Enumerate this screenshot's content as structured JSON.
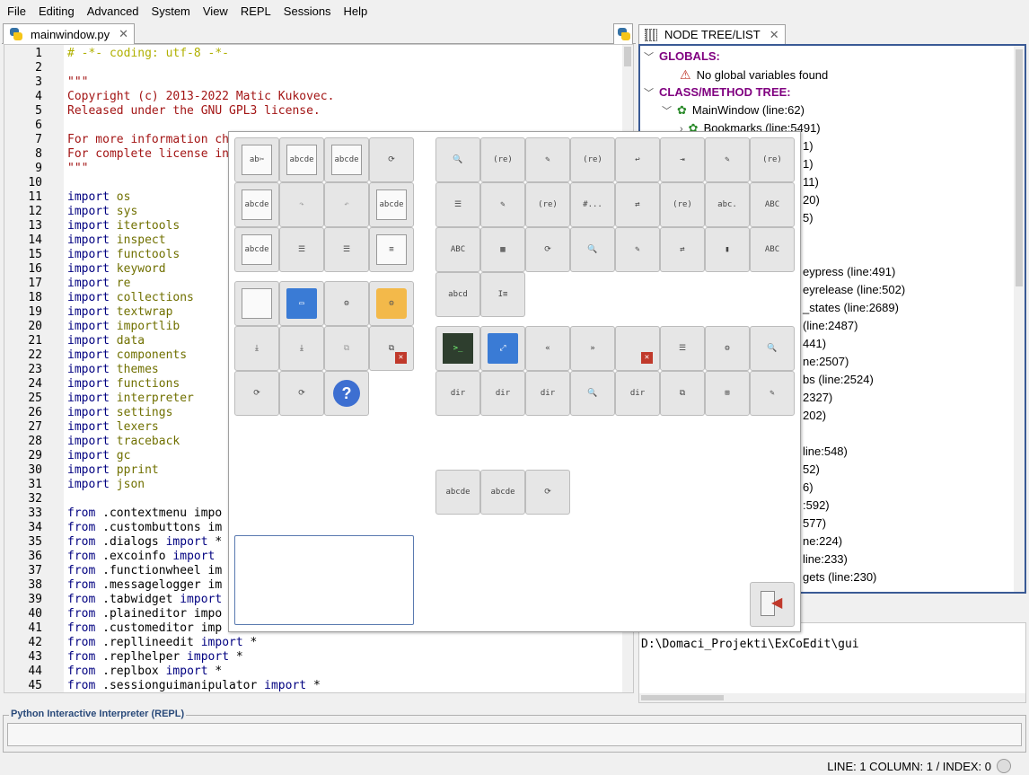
{
  "menu": [
    "File",
    "Editing",
    "Advanced",
    "System",
    "View",
    "REPL",
    "Sessions",
    "Help"
  ],
  "editor_tab": {
    "label": "mainwindow.py",
    "close": "✕"
  },
  "tree_tab": {
    "label": "NODE TREE/LIST",
    "close": "✕"
  },
  "code_lines": [
    {
      "n": "1",
      "t": "# -*- coding: utf-8 -*-",
      "c": "cm"
    },
    {
      "n": "2",
      "t": "",
      "c": ""
    },
    {
      "n": "3",
      "t": "\"\"\"",
      "c": "st"
    },
    {
      "n": "4",
      "t": "Copyright (c) 2013-2022 Matic Kukovec.",
      "c": "st"
    },
    {
      "n": "5",
      "t": "Released under the GNU GPL3 license.",
      "c": "st"
    },
    {
      "n": "6",
      "t": "",
      "c": ""
    },
    {
      "n": "7",
      "t": "For more information ch",
      "c": "st"
    },
    {
      "n": "8",
      "t": "For complete license in",
      "c": "st"
    },
    {
      "n": "9",
      "t": "\"\"\"",
      "c": "st"
    },
    {
      "n": "10",
      "t": "",
      "c": ""
    },
    {
      "n": "11",
      "t": "import os",
      "c": "imp"
    },
    {
      "n": "12",
      "t": "import sys",
      "c": "imp"
    },
    {
      "n": "13",
      "t": "import itertools",
      "c": "imp"
    },
    {
      "n": "14",
      "t": "import inspect",
      "c": "imp"
    },
    {
      "n": "15",
      "t": "import functools",
      "c": "imp"
    },
    {
      "n": "16",
      "t": "import keyword",
      "c": "imp"
    },
    {
      "n": "17",
      "t": "import re",
      "c": "imp"
    },
    {
      "n": "18",
      "t": "import collections",
      "c": "imp"
    },
    {
      "n": "19",
      "t": "import textwrap",
      "c": "imp"
    },
    {
      "n": "20",
      "t": "import importlib",
      "c": "imp"
    },
    {
      "n": "21",
      "t": "import data",
      "c": "imp"
    },
    {
      "n": "22",
      "t": "import components",
      "c": "imp"
    },
    {
      "n": "23",
      "t": "import themes",
      "c": "imp"
    },
    {
      "n": "24",
      "t": "import functions",
      "c": "imp"
    },
    {
      "n": "25",
      "t": "import interpreter",
      "c": "imp"
    },
    {
      "n": "26",
      "t": "import settings",
      "c": "imp"
    },
    {
      "n": "27",
      "t": "import lexers",
      "c": "imp"
    },
    {
      "n": "28",
      "t": "import traceback",
      "c": "imp"
    },
    {
      "n": "29",
      "t": "import gc",
      "c": "imp"
    },
    {
      "n": "30",
      "t": "import pprint",
      "c": "imp"
    },
    {
      "n": "31",
      "t": "import json",
      "c": "imp"
    },
    {
      "n": "32",
      "t": "",
      "c": ""
    },
    {
      "n": "33",
      "t": "from .contextmenu impo",
      "c": "from"
    },
    {
      "n": "34",
      "t": "from .custombuttons im",
      "c": "from"
    },
    {
      "n": "35",
      "t": "from .dialogs import *",
      "c": "from"
    },
    {
      "n": "36",
      "t": "from .excoinfo import ",
      "c": "from"
    },
    {
      "n": "37",
      "t": "from .functionwheel im",
      "c": "from"
    },
    {
      "n": "38",
      "t": "from .messagelogger im",
      "c": "from"
    },
    {
      "n": "39",
      "t": "from .tabwidget import",
      "c": "from"
    },
    {
      "n": "40",
      "t": "from .plaineditor impo",
      "c": "from"
    },
    {
      "n": "41",
      "t": "from .customeditor imp",
      "c": "from"
    },
    {
      "n": "42",
      "t": "from .repllineedit import *",
      "c": "from"
    },
    {
      "n": "43",
      "t": "from .replhelper import *",
      "c": "from"
    },
    {
      "n": "44",
      "t": "from .replbox import *",
      "c": "from"
    },
    {
      "n": "45",
      "t": "from .sessionguimanipulator import *",
      "c": "from"
    }
  ],
  "tree": {
    "globals_header": "GLOBALS:",
    "globals_msg": "No global variables found",
    "class_header": "CLASS/METHOD TREE:",
    "mainwindow": "MainWindow (line:62)",
    "bookmarks": "Bookmarks (line:5491)",
    "partial_rows": [
      "1)",
      "1)",
      "11)",
      "20)",
      "5)",
      "eypress (line:491)",
      "eyrelease (line:502)",
      "_states (line:2689)",
      "(line:2487)",
      "441)",
      "ne:2507)",
      "bs (line:2524)",
      "2327)",
      "202)",
      "line:548)",
      "52)",
      "6)",
      ":592)",
      "577)",
      "ne:224)",
      "line:233)",
      "gets (line:230)"
    ]
  },
  "path_text": "D:\\Domaci_Projekti\\ExCoEdit\\gui",
  "repl_label": "Python Interactive Interpreter (REPL)",
  "status": "LINE: 1 COLUMN: 1 / INDEX: 0",
  "tools_left": [
    {
      "name": "cut-tool",
      "glyph": "ab✂"
    },
    {
      "name": "copy-tool",
      "glyph": "abcde"
    },
    {
      "name": "paste-tool",
      "glyph": "abcde"
    },
    {
      "name": "refresh-tool",
      "glyph": "⟳"
    },
    {
      "name": "duplicate-line-tool",
      "glyph": "abcde"
    },
    {
      "name": "redo-tool",
      "glyph": "↷"
    },
    {
      "name": "undo-tool",
      "glyph": "↶"
    },
    {
      "name": "select-tool",
      "glyph": "abcde"
    },
    {
      "name": "strike-tool",
      "glyph": "abcde"
    },
    {
      "name": "indent-tool",
      "glyph": "☰"
    },
    {
      "name": "unindent-tool",
      "glyph": "☰"
    },
    {
      "name": "doc-tool",
      "glyph": "≡"
    },
    {
      "name": "new-file-tool",
      "glyph": ""
    },
    {
      "name": "open-folder-tool",
      "glyph": "▭"
    },
    {
      "name": "settings-tool",
      "glyph": "⚙"
    },
    {
      "name": "python-settings-tool",
      "glyph": "⚙"
    },
    {
      "name": "save-tool",
      "glyph": "⤓"
    },
    {
      "name": "save-as-tool",
      "glyph": "⤓"
    },
    {
      "name": "save-all-tool",
      "glyph": "⧉"
    },
    {
      "name": "close-all-tool",
      "glyph": "⧉"
    },
    {
      "name": "reload-settings-tool",
      "glyph": "⟳"
    },
    {
      "name": "reload-config-tool",
      "glyph": "⟳"
    },
    {
      "name": "help-tool",
      "glyph": "?"
    }
  ],
  "tools_right": [
    {
      "name": "find-tool",
      "glyph": "🔍"
    },
    {
      "name": "regex-find-tool",
      "glyph": "(re)"
    },
    {
      "name": "find-edit-tool",
      "glyph": "✎"
    },
    {
      "name": "regex-edit-tool",
      "glyph": "(re)"
    },
    {
      "name": "goto-tool",
      "glyph": "↩"
    },
    {
      "name": "goto-line-tool",
      "glyph": "⇥"
    },
    {
      "name": "edit-doc-tool",
      "glyph": "✎"
    },
    {
      "name": "regex-replace-tool",
      "glyph": "(re)"
    },
    {
      "name": "clear-tool",
      "glyph": "☰"
    },
    {
      "name": "highlight-tool",
      "glyph": "✎"
    },
    {
      "name": "regex-highlight-tool",
      "glyph": "(re)"
    },
    {
      "name": "comment-tool",
      "glyph": "#..."
    },
    {
      "name": "replace-all-tool",
      "glyph": "⇄"
    },
    {
      "name": "regex-replace-all-tool",
      "glyph": "(re)"
    },
    {
      "name": "split-tool",
      "glyph": "abc."
    },
    {
      "name": "case-tool",
      "glyph": "ABC"
    },
    {
      "name": "abc-lower-tool",
      "glyph": "ABC"
    },
    {
      "name": "grid-tool",
      "glyph": "▦"
    },
    {
      "name": "reload-tool",
      "glyph": "⟳"
    },
    {
      "name": "find-in-files-tool",
      "glyph": "🔍"
    },
    {
      "name": "find-edit-files-tool",
      "glyph": "✎"
    },
    {
      "name": "replace-files-tool",
      "glyph": "⇄"
    },
    {
      "name": "bookmark-tool",
      "glyph": "▮"
    },
    {
      "name": "to-de-tool",
      "glyph": "ABC"
    },
    {
      "name": "column-tool",
      "glyph": "abcd"
    },
    {
      "name": "text-cursor-tool",
      "glyph": "I≡"
    },
    {
      "name": "terminal-tool",
      "glyph": ">_"
    },
    {
      "name": "maximize-tool",
      "glyph": "⤢"
    },
    {
      "name": "move-left-tool",
      "glyph": "«"
    },
    {
      "name": "move-right-tool",
      "glyph": "»"
    },
    {
      "name": "close-window-tool",
      "glyph": ""
    },
    {
      "name": "list-tool",
      "glyph": "☰"
    },
    {
      "name": "search-settings-tool",
      "glyph": "⚙"
    },
    {
      "name": "search-files-tool",
      "glyph": "🔍"
    },
    {
      "name": "find-dir-tool",
      "glyph": "dir"
    },
    {
      "name": "find-dir-regex-tool",
      "glyph": "dir"
    },
    {
      "name": "find-dir-replace-tool",
      "glyph": "dir"
    },
    {
      "name": "search-folder-tool",
      "glyph": "🔍"
    },
    {
      "name": "edit-dir-tool",
      "glyph": "dir"
    },
    {
      "name": "window-tool",
      "glyph": "⧉"
    },
    {
      "name": "bucket-tool",
      "glyph": "⊞"
    },
    {
      "name": "style-tool",
      "glyph": "✎"
    },
    {
      "name": "py-abcde-tool",
      "glyph": "abcde"
    },
    {
      "name": "py-abcde2-tool",
      "glyph": "abcde"
    },
    {
      "name": "py-refresh-tool",
      "glyph": "⟳"
    }
  ]
}
